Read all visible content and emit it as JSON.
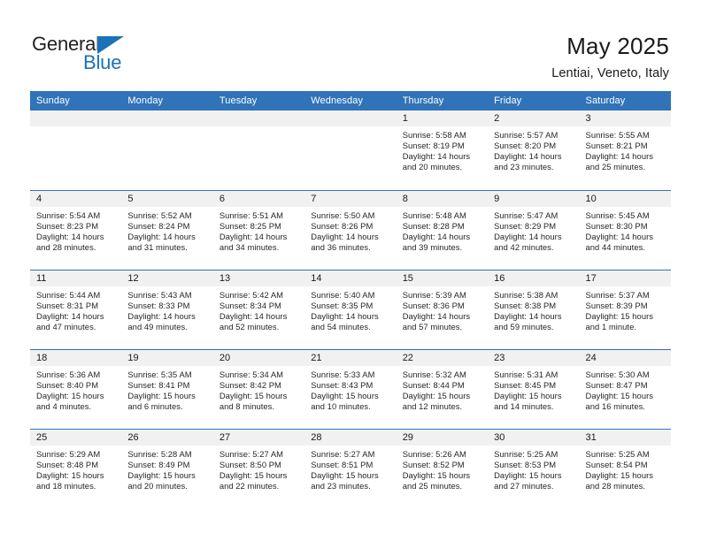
{
  "brand": {
    "name_part1": "General",
    "name_part2": "Blue",
    "accent_color": "#1c71b8"
  },
  "header": {
    "title": "May 2025",
    "subtitle": "Lentiai, Veneto, Italy",
    "header_bg_color": "#3173b8",
    "daynum_band_color": "#f1f1f1"
  },
  "weekday_headers": [
    "Sunday",
    "Monday",
    "Tuesday",
    "Wednesday",
    "Thursday",
    "Friday",
    "Saturday"
  ],
  "weeks": [
    [
      {
        "day": "",
        "sunrise": "",
        "sunset": "",
        "daylight_line1": "",
        "daylight_line2": ""
      },
      {
        "day": "",
        "sunrise": "",
        "sunset": "",
        "daylight_line1": "",
        "daylight_line2": ""
      },
      {
        "day": "",
        "sunrise": "",
        "sunset": "",
        "daylight_line1": "",
        "daylight_line2": ""
      },
      {
        "day": "",
        "sunrise": "",
        "sunset": "",
        "daylight_line1": "",
        "daylight_line2": ""
      },
      {
        "day": "1",
        "sunrise": "Sunrise: 5:58 AM",
        "sunset": "Sunset: 8:19 PM",
        "daylight_line1": "Daylight: 14 hours",
        "daylight_line2": "and 20 minutes."
      },
      {
        "day": "2",
        "sunrise": "Sunrise: 5:57 AM",
        "sunset": "Sunset: 8:20 PM",
        "daylight_line1": "Daylight: 14 hours",
        "daylight_line2": "and 23 minutes."
      },
      {
        "day": "3",
        "sunrise": "Sunrise: 5:55 AM",
        "sunset": "Sunset: 8:21 PM",
        "daylight_line1": "Daylight: 14 hours",
        "daylight_line2": "and 25 minutes."
      }
    ],
    [
      {
        "day": "4",
        "sunrise": "Sunrise: 5:54 AM",
        "sunset": "Sunset: 8:23 PM",
        "daylight_line1": "Daylight: 14 hours",
        "daylight_line2": "and 28 minutes."
      },
      {
        "day": "5",
        "sunrise": "Sunrise: 5:52 AM",
        "sunset": "Sunset: 8:24 PM",
        "daylight_line1": "Daylight: 14 hours",
        "daylight_line2": "and 31 minutes."
      },
      {
        "day": "6",
        "sunrise": "Sunrise: 5:51 AM",
        "sunset": "Sunset: 8:25 PM",
        "daylight_line1": "Daylight: 14 hours",
        "daylight_line2": "and 34 minutes."
      },
      {
        "day": "7",
        "sunrise": "Sunrise: 5:50 AM",
        "sunset": "Sunset: 8:26 PM",
        "daylight_line1": "Daylight: 14 hours",
        "daylight_line2": "and 36 minutes."
      },
      {
        "day": "8",
        "sunrise": "Sunrise: 5:48 AM",
        "sunset": "Sunset: 8:28 PM",
        "daylight_line1": "Daylight: 14 hours",
        "daylight_line2": "and 39 minutes."
      },
      {
        "day": "9",
        "sunrise": "Sunrise: 5:47 AM",
        "sunset": "Sunset: 8:29 PM",
        "daylight_line1": "Daylight: 14 hours",
        "daylight_line2": "and 42 minutes."
      },
      {
        "day": "10",
        "sunrise": "Sunrise: 5:45 AM",
        "sunset": "Sunset: 8:30 PM",
        "daylight_line1": "Daylight: 14 hours",
        "daylight_line2": "and 44 minutes."
      }
    ],
    [
      {
        "day": "11",
        "sunrise": "Sunrise: 5:44 AM",
        "sunset": "Sunset: 8:31 PM",
        "daylight_line1": "Daylight: 14 hours",
        "daylight_line2": "and 47 minutes."
      },
      {
        "day": "12",
        "sunrise": "Sunrise: 5:43 AM",
        "sunset": "Sunset: 8:33 PM",
        "daylight_line1": "Daylight: 14 hours",
        "daylight_line2": "and 49 minutes."
      },
      {
        "day": "13",
        "sunrise": "Sunrise: 5:42 AM",
        "sunset": "Sunset: 8:34 PM",
        "daylight_line1": "Daylight: 14 hours",
        "daylight_line2": "and 52 minutes."
      },
      {
        "day": "14",
        "sunrise": "Sunrise: 5:40 AM",
        "sunset": "Sunset: 8:35 PM",
        "daylight_line1": "Daylight: 14 hours",
        "daylight_line2": "and 54 minutes."
      },
      {
        "day": "15",
        "sunrise": "Sunrise: 5:39 AM",
        "sunset": "Sunset: 8:36 PM",
        "daylight_line1": "Daylight: 14 hours",
        "daylight_line2": "and 57 minutes."
      },
      {
        "day": "16",
        "sunrise": "Sunrise: 5:38 AM",
        "sunset": "Sunset: 8:38 PM",
        "daylight_line1": "Daylight: 14 hours",
        "daylight_line2": "and 59 minutes."
      },
      {
        "day": "17",
        "sunrise": "Sunrise: 5:37 AM",
        "sunset": "Sunset: 8:39 PM",
        "daylight_line1": "Daylight: 15 hours",
        "daylight_line2": "and 1 minute."
      }
    ],
    [
      {
        "day": "18",
        "sunrise": "Sunrise: 5:36 AM",
        "sunset": "Sunset: 8:40 PM",
        "daylight_line1": "Daylight: 15 hours",
        "daylight_line2": "and 4 minutes."
      },
      {
        "day": "19",
        "sunrise": "Sunrise: 5:35 AM",
        "sunset": "Sunset: 8:41 PM",
        "daylight_line1": "Daylight: 15 hours",
        "daylight_line2": "and 6 minutes."
      },
      {
        "day": "20",
        "sunrise": "Sunrise: 5:34 AM",
        "sunset": "Sunset: 8:42 PM",
        "daylight_line1": "Daylight: 15 hours",
        "daylight_line2": "and 8 minutes."
      },
      {
        "day": "21",
        "sunrise": "Sunrise: 5:33 AM",
        "sunset": "Sunset: 8:43 PM",
        "daylight_line1": "Daylight: 15 hours",
        "daylight_line2": "and 10 minutes."
      },
      {
        "day": "22",
        "sunrise": "Sunrise: 5:32 AM",
        "sunset": "Sunset: 8:44 PM",
        "daylight_line1": "Daylight: 15 hours",
        "daylight_line2": "and 12 minutes."
      },
      {
        "day": "23",
        "sunrise": "Sunrise: 5:31 AM",
        "sunset": "Sunset: 8:45 PM",
        "daylight_line1": "Daylight: 15 hours",
        "daylight_line2": "and 14 minutes."
      },
      {
        "day": "24",
        "sunrise": "Sunrise: 5:30 AM",
        "sunset": "Sunset: 8:47 PM",
        "daylight_line1": "Daylight: 15 hours",
        "daylight_line2": "and 16 minutes."
      }
    ],
    [
      {
        "day": "25",
        "sunrise": "Sunrise: 5:29 AM",
        "sunset": "Sunset: 8:48 PM",
        "daylight_line1": "Daylight: 15 hours",
        "daylight_line2": "and 18 minutes."
      },
      {
        "day": "26",
        "sunrise": "Sunrise: 5:28 AM",
        "sunset": "Sunset: 8:49 PM",
        "daylight_line1": "Daylight: 15 hours",
        "daylight_line2": "and 20 minutes."
      },
      {
        "day": "27",
        "sunrise": "Sunrise: 5:27 AM",
        "sunset": "Sunset: 8:50 PM",
        "daylight_line1": "Daylight: 15 hours",
        "daylight_line2": "and 22 minutes."
      },
      {
        "day": "28",
        "sunrise": "Sunrise: 5:27 AM",
        "sunset": "Sunset: 8:51 PM",
        "daylight_line1": "Daylight: 15 hours",
        "daylight_line2": "and 23 minutes."
      },
      {
        "day": "29",
        "sunrise": "Sunrise: 5:26 AM",
        "sunset": "Sunset: 8:52 PM",
        "daylight_line1": "Daylight: 15 hours",
        "daylight_line2": "and 25 minutes."
      },
      {
        "day": "30",
        "sunrise": "Sunrise: 5:25 AM",
        "sunset": "Sunset: 8:53 PM",
        "daylight_line1": "Daylight: 15 hours",
        "daylight_line2": "and 27 minutes."
      },
      {
        "day": "31",
        "sunrise": "Sunrise: 5:25 AM",
        "sunset": "Sunset: 8:54 PM",
        "daylight_line1": "Daylight: 15 hours",
        "daylight_line2": "and 28 minutes."
      }
    ]
  ]
}
